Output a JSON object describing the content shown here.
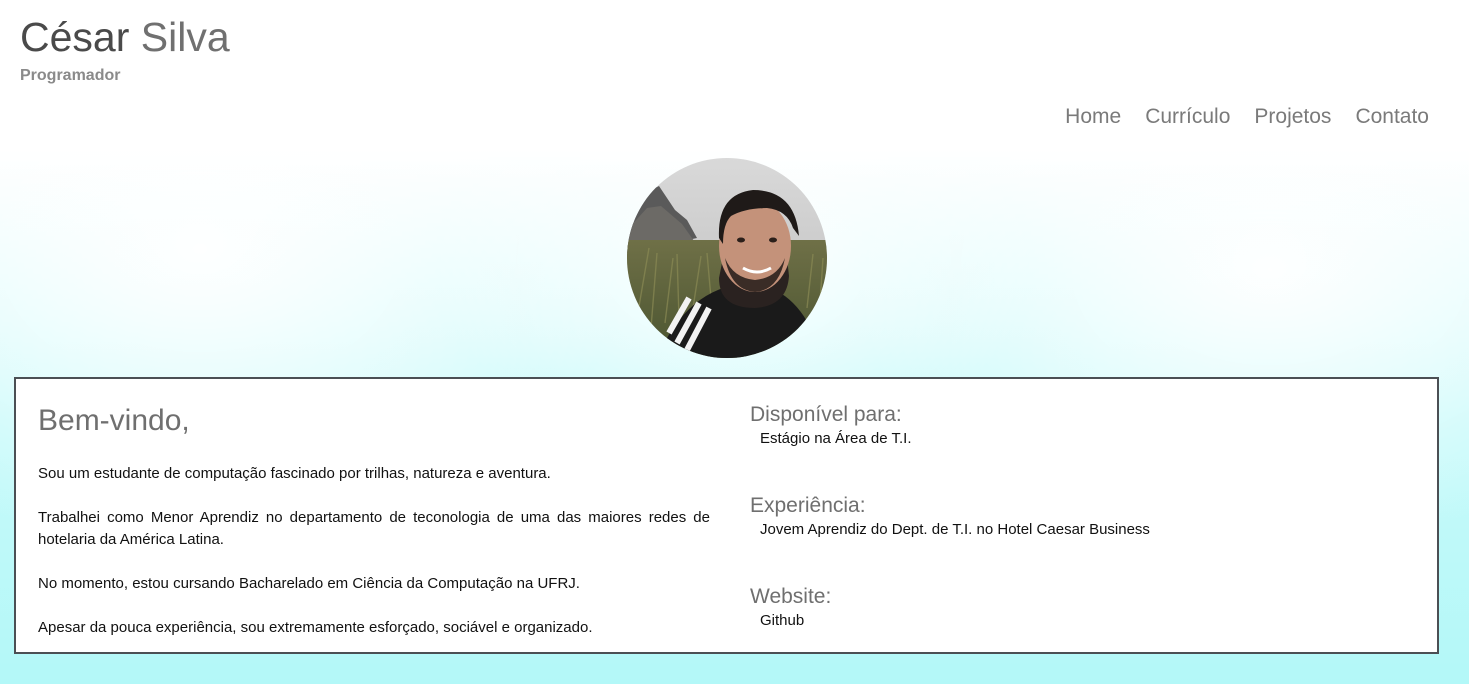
{
  "header": {
    "first_name": "César",
    "last_name": "Silva",
    "subtitle": "Programador"
  },
  "nav": {
    "items": [
      {
        "label": "Home"
      },
      {
        "label": "Currículo"
      },
      {
        "label": "Projetos"
      },
      {
        "label": "Contato"
      }
    ]
  },
  "profile": {
    "photo_icon": "profile-photo"
  },
  "welcome": {
    "title": "Bem-vindo,",
    "paragraphs": [
      "Sou um estudante de computação fascinado por trilhas, natureza e aventura.",
      "Trabalhei como Menor Aprendiz no departamento de teconologia de uma das maiores redes de hotelaria da América Latina.",
      "No momento, estou cursando Bacharelado em Ciência da Computação na UFRJ.",
      "Apesar da pouca experiência, sou extremamente esforçado, sociável e organizado."
    ]
  },
  "info": {
    "available_title": "Disponível para:",
    "available_value": "Estágio na Área de T.I.",
    "experience_title": "Experiência:",
    "experience_value": "Jovem Aprendiz do Dept. de T.I. no Hotel Caesar Business",
    "website_title": "Website:",
    "website_value": "Github"
  },
  "colors": {
    "background_accent": "#b3f8f8",
    "border": "#4b4f54",
    "muted_text": "#707070"
  }
}
